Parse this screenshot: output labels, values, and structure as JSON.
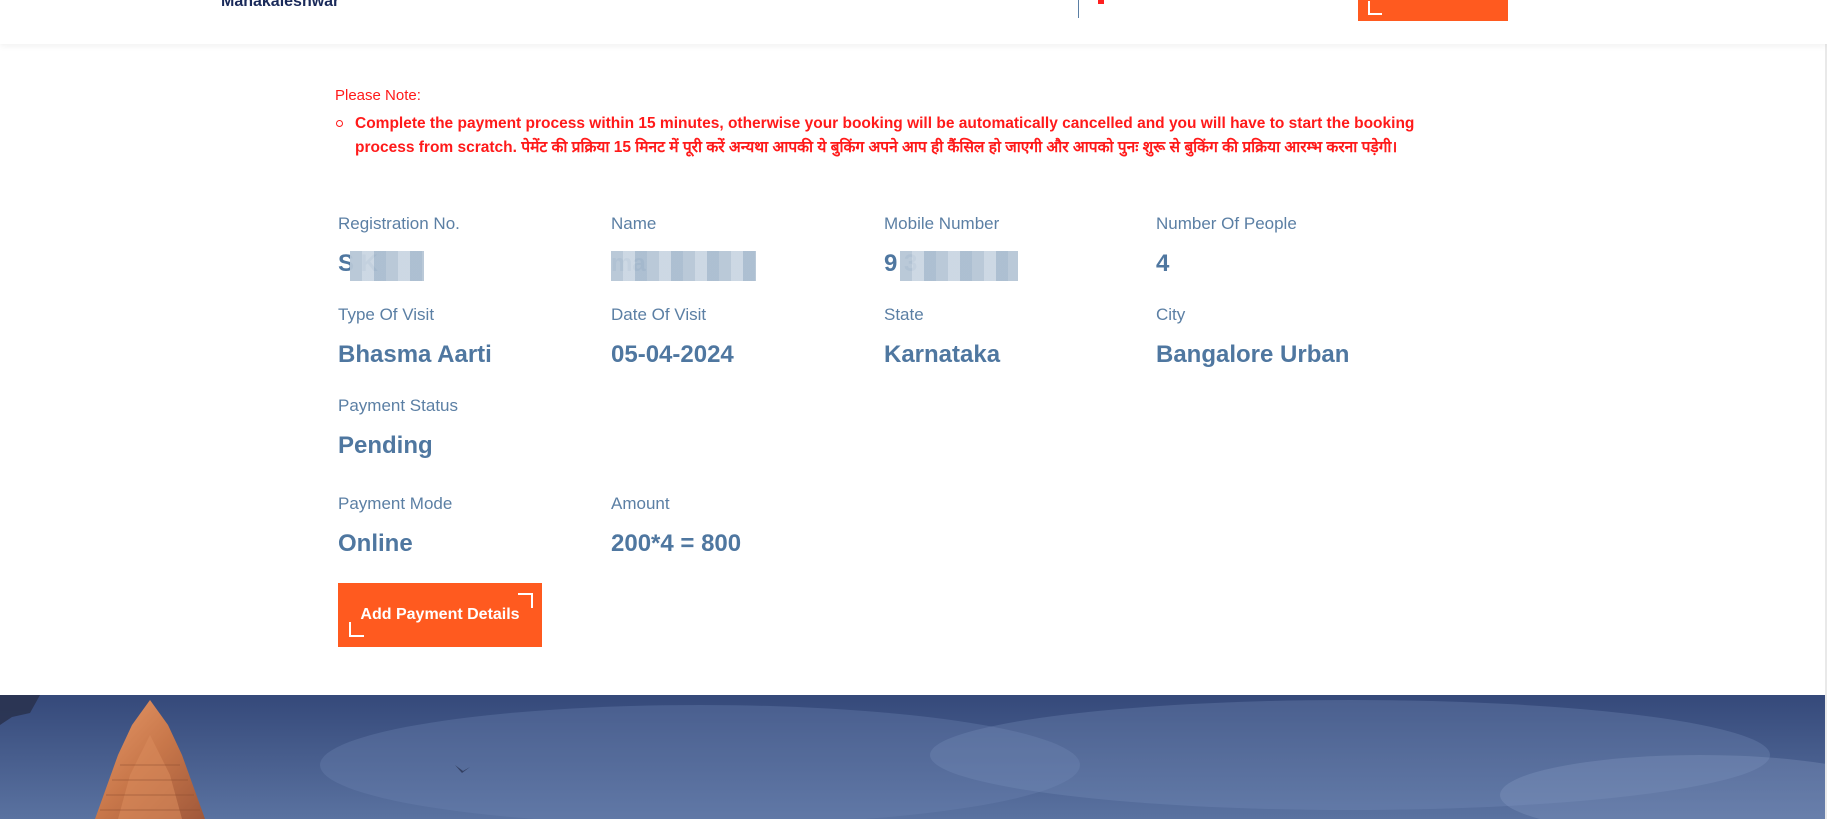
{
  "header": {
    "brand_sub": "Mahakaleshwar"
  },
  "note": {
    "title": "Please Note:",
    "items": [
      "Complete the payment process within 15 minutes, otherwise your booking will be automatically cancelled and you will have to start the booking process from scratch. पेमेंट की प्रक्रिया 15 मिनट में पूरी करें अन्यथा आपकी ये बुकिंग अपने आप ही कैंसिल हो जाएगी और आपको पुनः शुरू से बुकिंग की प्रक्रिया आरम्भ करना पड़ेगी।"
    ]
  },
  "details": {
    "registration_no": {
      "label": "Registration No.",
      "value": "S    K"
    },
    "name": {
      "label": "Name",
      "value": "          ma"
    },
    "mobile_number": {
      "label": "Mobile Number",
      "value": "9        3"
    },
    "number_of_people": {
      "label": "Number Of People",
      "value": "4"
    },
    "type_of_visit": {
      "label": "Type Of Visit",
      "value": "Bhasma Aarti"
    },
    "date_of_visit": {
      "label": "Date Of Visit",
      "value": "05-04-2024"
    },
    "state": {
      "label": "State",
      "value": "Karnataka"
    },
    "city": {
      "label": "City",
      "value": "Bangalore Urban"
    },
    "payment_status": {
      "label": "Payment Status",
      "value": "Pending"
    },
    "payment_mode": {
      "label": "Payment Mode",
      "value": "Online"
    },
    "amount": {
      "label": "Amount",
      "value": "200*4 = 800"
    }
  },
  "actions": {
    "add_payment_label": "Add Payment Details"
  },
  "colors": {
    "accent": "#ff5a1f",
    "note_red": "#ff1a1a",
    "label_blue": "#5b7fa4",
    "value_blue": "#4f77a0"
  }
}
